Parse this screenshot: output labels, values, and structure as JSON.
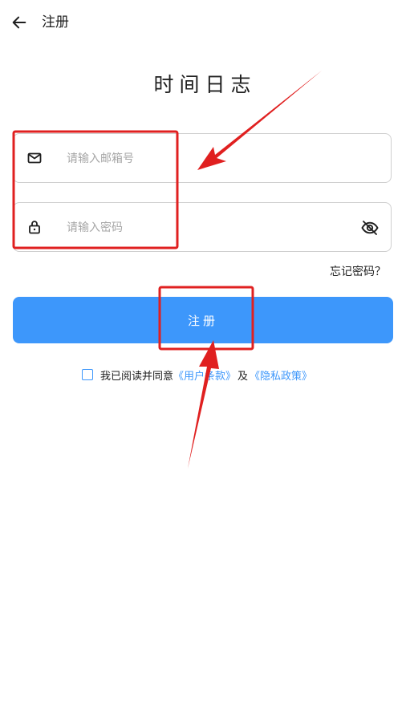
{
  "header": {
    "title": "注册"
  },
  "app_title": "时间日志",
  "form": {
    "email_placeholder": "请输入邮箱号",
    "email_value": "",
    "password_placeholder": "请输入密码",
    "password_value": "",
    "forgot_label": "忘记密码？",
    "register_label": "注册"
  },
  "agreement": {
    "text": "我已阅读并同意",
    "terms_link": "《用户条款》",
    "and": "及",
    "privacy_link": "《隐私政策》",
    "checked": false
  },
  "icons": {
    "back": "arrow-left-icon",
    "email": "mail-icon",
    "password": "lock-icon",
    "visibility": "eye-off-icon"
  },
  "colors": {
    "accent": "#3d97fb",
    "annotation": "#e02020",
    "border": "#cfcfcf",
    "placeholder": "#a6a6a6"
  }
}
